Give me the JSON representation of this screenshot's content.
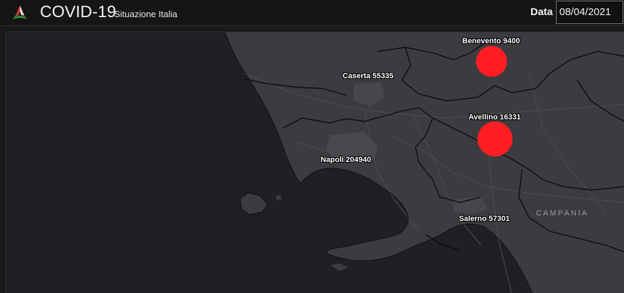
{
  "header": {
    "title": "COVID-19",
    "subtitle": "Situazione Italia",
    "date_label": "Data",
    "date_value": "08/04/2021",
    "logo_icon": "italy-tricolor-logo-icon"
  },
  "map": {
    "region_label": "CAMPANIA",
    "colors": {
      "sea": "#201f24",
      "land": "#3c3b40",
      "borders": "#0d0d0d",
      "urban": "#4a494e",
      "roads": "#48474c",
      "marker": "#ff1e24"
    },
    "markers": [
      {
        "city": "Benevento",
        "value": "9400"
      },
      {
        "city": "Caserta",
        "value": "55335"
      },
      {
        "city": "Avellino",
        "value": "16331"
      },
      {
        "city": "Napoli",
        "value": "204940"
      },
      {
        "city": "Salerno",
        "value": "57301"
      }
    ],
    "marker_labels": [
      "Benevento 9400",
      "Caserta 55335",
      "Avellino 16331",
      "Napoli 204940",
      "Salerno 57301"
    ]
  }
}
